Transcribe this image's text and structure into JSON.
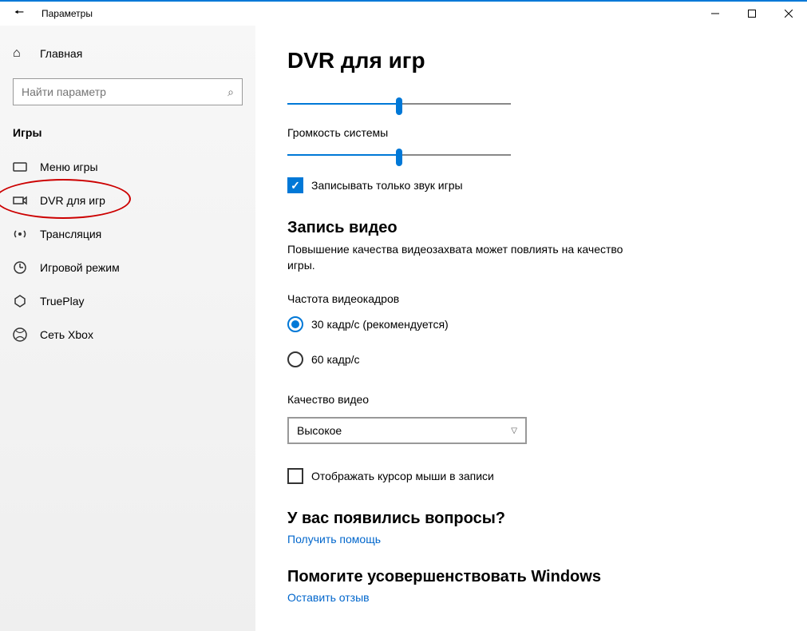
{
  "titlebar": {
    "title": "Параметры"
  },
  "sidebar": {
    "home": "Главная",
    "search_placeholder": "Найти параметр",
    "category": "Игры",
    "items": [
      {
        "label": "Меню игры"
      },
      {
        "label": "DVR для игр"
      },
      {
        "label": "Трансляция"
      },
      {
        "label": "Игровой режим"
      },
      {
        "label": "TruePlay"
      },
      {
        "label": "Сеть Xbox"
      }
    ]
  },
  "main": {
    "heading": "DVR для игр",
    "slider1": {
      "value": 50
    },
    "slider2": {
      "label": "Громкость системы",
      "value": 50
    },
    "record_only_game": "Записывать только звук игры",
    "video_section": {
      "title": "Запись видео",
      "desc": "Повышение качества видеозахвата может повлиять на качество игры.",
      "framerate_label": "Частота видеокадров",
      "fr30": "30 кадр/с (рекомендуется)",
      "fr60": "60 кадр/с",
      "quality_label": "Качество видео",
      "quality_value": "Высокое",
      "cursor": "Отображать курсор мыши в записи"
    },
    "help": {
      "title": "У вас появились вопросы?",
      "link": "Получить помощь"
    },
    "feedback": {
      "title": "Помогите усовершенствовать Windows",
      "link": "Оставить отзыв"
    }
  }
}
